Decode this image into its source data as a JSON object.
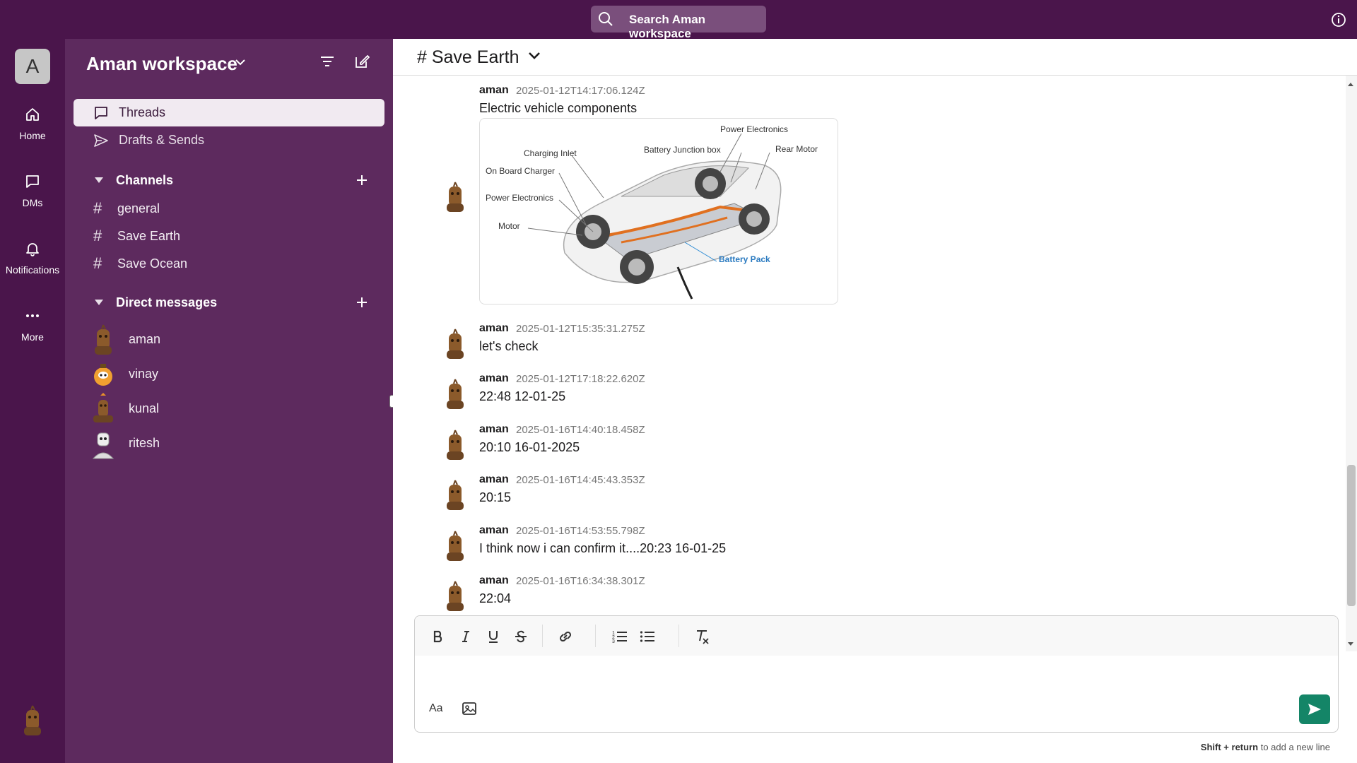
{
  "topbar": {
    "search_label": "Search Aman workspace"
  },
  "rail": {
    "workspace_initial": "A",
    "items": [
      {
        "label": "Home",
        "icon": "home-icon"
      },
      {
        "label": "DMs",
        "icon": "message-icon"
      },
      {
        "label": "Notifications",
        "icon": "bell-icon"
      },
      {
        "label": "More",
        "icon": "more-icon"
      }
    ]
  },
  "sidebar": {
    "workspace_name": "Aman workspace",
    "nav": [
      {
        "label": "Threads",
        "icon": "threads-icon",
        "active": true
      },
      {
        "label": "Drafts & Sends",
        "icon": "send-icon",
        "active": false
      }
    ],
    "channels_label": "Channels",
    "channels": [
      {
        "name": "general"
      },
      {
        "name": "Save Earth"
      },
      {
        "name": "Save Ocean"
      }
    ],
    "dms_label": "Direct messages",
    "dms": [
      {
        "name": "aman"
      },
      {
        "name": "vinay"
      },
      {
        "name": "kunal"
      },
      {
        "name": "ritesh"
      }
    ]
  },
  "channel": {
    "title": "# Save Earth"
  },
  "messages": [
    {
      "author": "aman",
      "time": "2025-01-12T14:17:06.124Z",
      "text": "Electric vehicle components",
      "attachment": {
        "labels": [
          "Power Electronics",
          "Charging Inlet",
          "Battery Junction box",
          "Rear Motor",
          "On Board Charger",
          "Power Electronics",
          "Motor",
          "Battery Pack"
        ]
      }
    },
    {
      "author": "aman",
      "time": "2025-01-12T15:35:31.275Z",
      "text": "let's check"
    },
    {
      "author": "aman",
      "time": "2025-01-12T17:18:22.620Z",
      "text": "22:48 12-01-25"
    },
    {
      "author": "aman",
      "time": "2025-01-16T14:40:18.458Z",
      "text": "20:10 16-01-2025"
    },
    {
      "author": "aman",
      "time": "2025-01-16T14:45:43.353Z",
      "text": "20:15"
    },
    {
      "author": "aman",
      "time": "2025-01-16T14:53:55.798Z",
      "text": "I think now i can confirm it....20:23 16-01-25"
    },
    {
      "author": "aman",
      "time": "2025-01-16T16:34:38.301Z",
      "text": "22:04"
    }
  ],
  "composer": {
    "format_label": "Aa",
    "hint_key1": "Shift",
    "hint_plus": "+",
    "hint_key2": "return",
    "hint_text": "to add a new line"
  }
}
